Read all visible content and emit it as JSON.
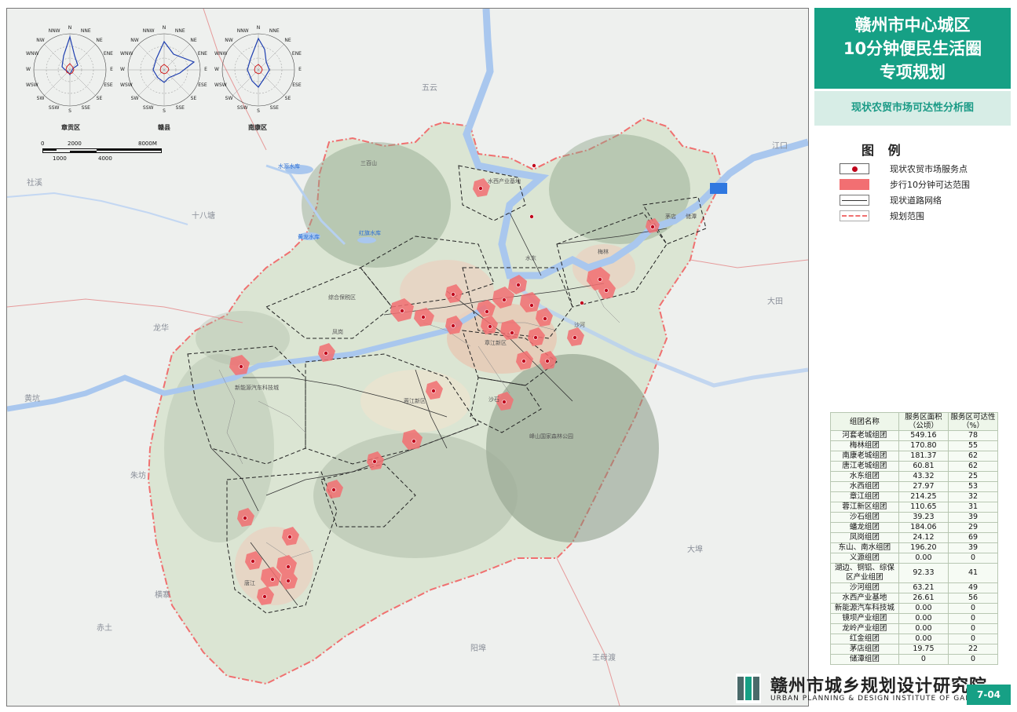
{
  "title": {
    "line1": "赣州市中心城区",
    "line2": "10分钟便民生活圈",
    "line3": "专项规划"
  },
  "subtitle": "现状农贸市场可达性分析图",
  "legend": {
    "title": "图 例",
    "items": [
      {
        "label": "现状农贸市场服务点",
        "symbol": "red-dot"
      },
      {
        "label": "步行10分钟可达范围",
        "symbol": "red-fill"
      },
      {
        "label": "现状道路网络",
        "symbol": "road-line"
      },
      {
        "label": "规划范围",
        "symbol": "dashed-boundary"
      }
    ]
  },
  "wind_roses": [
    {
      "label": "章贡区"
    },
    {
      "label": "赣县"
    },
    {
      "label": "南康区"
    }
  ],
  "compass": [
    "N",
    "NNE",
    "NE",
    "ENE",
    "E",
    "ESE",
    "SE",
    "SSE",
    "S",
    "SSW",
    "SW",
    "WSW",
    "W",
    "WNW",
    "NW",
    "NNW"
  ],
  "scale_bar": {
    "top_labels": [
      "0",
      "2000",
      "8000M"
    ],
    "bottom_labels": [
      "1000",
      "4000"
    ]
  },
  "table": {
    "headers": [
      "组团名称",
      "服务区面积（公顷）",
      "服务区可达性（%）"
    ],
    "rows": [
      [
        "河套老城组团",
        "549.16",
        "78"
      ],
      [
        "梅林组团",
        "170.80",
        "55"
      ],
      [
        "南康老城组团",
        "181.37",
        "62"
      ],
      [
        "唐江老城组团",
        "60.81",
        "62"
      ],
      [
        "水东组团",
        "43.32",
        "25"
      ],
      [
        "水西组团",
        "27.97",
        "53"
      ],
      [
        "章江组团",
        "214.25",
        "32"
      ],
      [
        "蓉江新区组团",
        "110.65",
        "31"
      ],
      [
        "沙石组团",
        "39.23",
        "39"
      ],
      [
        "蟠龙组团",
        "184.06",
        "29"
      ],
      [
        "凤岗组团",
        "24.12",
        "69"
      ],
      [
        "东山、南水组团",
        "196.20",
        "39"
      ],
      [
        "义源组团",
        "0.00",
        "0"
      ],
      [
        "湖边、铜铝、综保区产业组团",
        "92.33",
        "41"
      ],
      [
        "沙河组团",
        "63.21",
        "49"
      ],
      [
        "水西产业基地",
        "26.61",
        "56"
      ],
      [
        "新能源汽车科技城",
        "0.00",
        "0"
      ],
      [
        "镜坝产业组团",
        "0.00",
        "0"
      ],
      [
        "龙岭产业组团",
        "0.00",
        "0"
      ],
      [
        "红金组团",
        "0.00",
        "0"
      ],
      [
        "茅店组团",
        "19.75",
        "22"
      ],
      [
        "储潭组团",
        "0",
        "0"
      ]
    ]
  },
  "place_labels": [
    "社溪",
    "十八塘",
    "龙华",
    "黄坑",
    "朱坊",
    "横寨",
    "赤土",
    "阳埠",
    "王母渡",
    "大埠",
    "大田",
    "江口",
    "五云",
    "三百山",
    "水西产业基地",
    "水东",
    "梅林",
    "沙河",
    "章江新区",
    "蓉江新区",
    "沙石",
    "凤岗",
    "唐江",
    "新能源汽车科技城",
    "综合保税区",
    "峰山国家森林公园",
    "黄龙水库",
    "红旗水库",
    "水源水库",
    "茅店",
    "储潭"
  ],
  "institute": {
    "cn": "赣州市城乡规划设计研究院",
    "en": "URBAN PLANNING & DESIGN INSTITUTE OF GANZHOU"
  },
  "map_number": "7-04",
  "colors": {
    "accent": "#16a085",
    "service_area": "#f26f72",
    "market_dot": "#c0001a",
    "boundary": "#f07070"
  }
}
